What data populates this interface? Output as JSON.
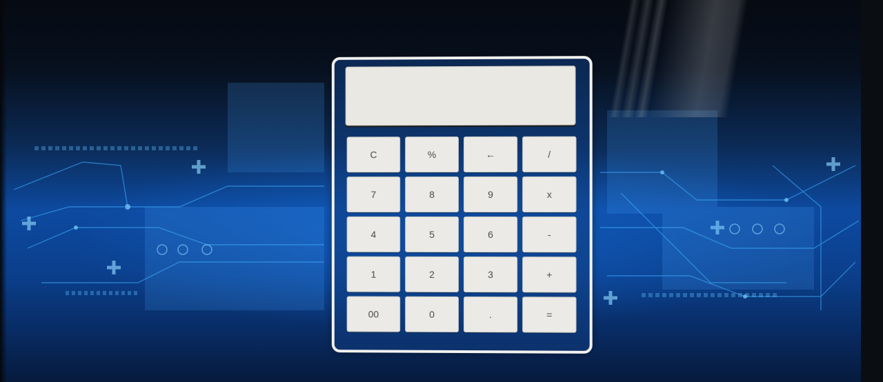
{
  "calculator": {
    "display_value": "",
    "keys": [
      {
        "label": "C",
        "name": "clear-button"
      },
      {
        "label": "%",
        "name": "percent-button"
      },
      {
        "label": "←",
        "name": "backspace-button"
      },
      {
        "label": "/",
        "name": "divide-button"
      },
      {
        "label": "7",
        "name": "digit-7-button"
      },
      {
        "label": "8",
        "name": "digit-8-button"
      },
      {
        "label": "9",
        "name": "digit-9-button"
      },
      {
        "label": "x",
        "name": "multiply-button"
      },
      {
        "label": "4",
        "name": "digit-4-button"
      },
      {
        "label": "5",
        "name": "digit-5-button"
      },
      {
        "label": "6",
        "name": "digit-6-button"
      },
      {
        "label": "-",
        "name": "subtract-button"
      },
      {
        "label": "1",
        "name": "digit-1-button"
      },
      {
        "label": "2",
        "name": "digit-2-button"
      },
      {
        "label": "3",
        "name": "digit-3-button"
      },
      {
        "label": "+",
        "name": "add-button"
      },
      {
        "label": "00",
        "name": "double-zero-button"
      },
      {
        "label": "0",
        "name": "digit-0-button"
      },
      {
        "label": ".",
        "name": "decimal-button"
      },
      {
        "label": "=",
        "name": "equals-button"
      }
    ]
  },
  "colors": {
    "frame": "#f1f1ef",
    "key_face": "#ebeae6",
    "background_accent": "#0d4aa0"
  }
}
